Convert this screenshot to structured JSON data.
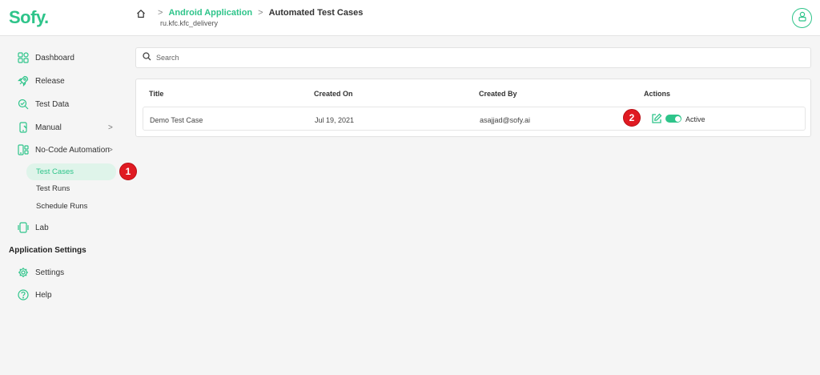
{
  "app": {
    "logo": "Sofy."
  },
  "breadcrumb": {
    "separator": ">",
    "app_name": "Android Application",
    "page": "Automated Test Cases",
    "package": "ru.kfc.kfc_delivery"
  },
  "sidebar": {
    "items": [
      {
        "label": "Dashboard",
        "icon": "dashboard-icon"
      },
      {
        "label": "Release",
        "icon": "rocket-icon"
      },
      {
        "label": "Test Data",
        "icon": "test-data-icon"
      },
      {
        "label": "Manual",
        "icon": "mobile-icon",
        "chevron": ">"
      },
      {
        "label": "No-Code Automation",
        "icon": "automation-icon",
        "chevron": ">"
      },
      {
        "label": "Lab",
        "icon": "lab-icon"
      }
    ],
    "sub_items": {
      "active": "Test Cases",
      "runs": "Test Runs",
      "schedule": "Schedule Runs"
    },
    "section_title": "Application Settings",
    "settings": {
      "label": "Settings",
      "icon": "gear-icon"
    },
    "help": {
      "label": "Help",
      "icon": "help-icon"
    }
  },
  "search": {
    "placeholder": "Search",
    "value": ""
  },
  "table": {
    "headers": [
      "Title",
      "Created On",
      "Created By",
      "Actions"
    ],
    "rows": [
      {
        "title": "Demo Test Case",
        "created_on": "Jul 19, 2021",
        "created_by": "asajjad@sofy.ai",
        "status": "Active"
      }
    ]
  },
  "markers": {
    "one": "1",
    "two": "2"
  },
  "colors": {
    "accent": "#2ec48a",
    "marker": "#e01a22"
  }
}
